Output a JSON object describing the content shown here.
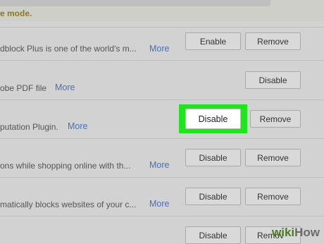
{
  "notice": "e mode.",
  "rows": [
    {
      "description": "dblock Plus is one of the world's m...",
      "more": "More",
      "primary": "Enable",
      "secondary": "Remove"
    },
    {
      "description": "obe PDF file",
      "more": "More",
      "primary": "Disable",
      "secondary": ""
    },
    {
      "description": "putation Plugin.",
      "more": "More",
      "primary": "Disable",
      "secondary": "Remove"
    },
    {
      "description": "ons while shopping online with th...",
      "more": "More",
      "primary": "Disable",
      "secondary": "Remove"
    },
    {
      "description": "matically blocks websites of your c...",
      "more": "More",
      "primary": "Disable",
      "secondary": "Remove"
    },
    {
      "description": "",
      "more": "",
      "primary": "Disable",
      "secondary": "Remov"
    }
  ],
  "watermark": {
    "prefix": "wiki",
    "suffix": "How"
  },
  "colors": {
    "highlight": "#1ee51e",
    "link": "#4a6fb0",
    "notice": "#8b7a1a"
  }
}
